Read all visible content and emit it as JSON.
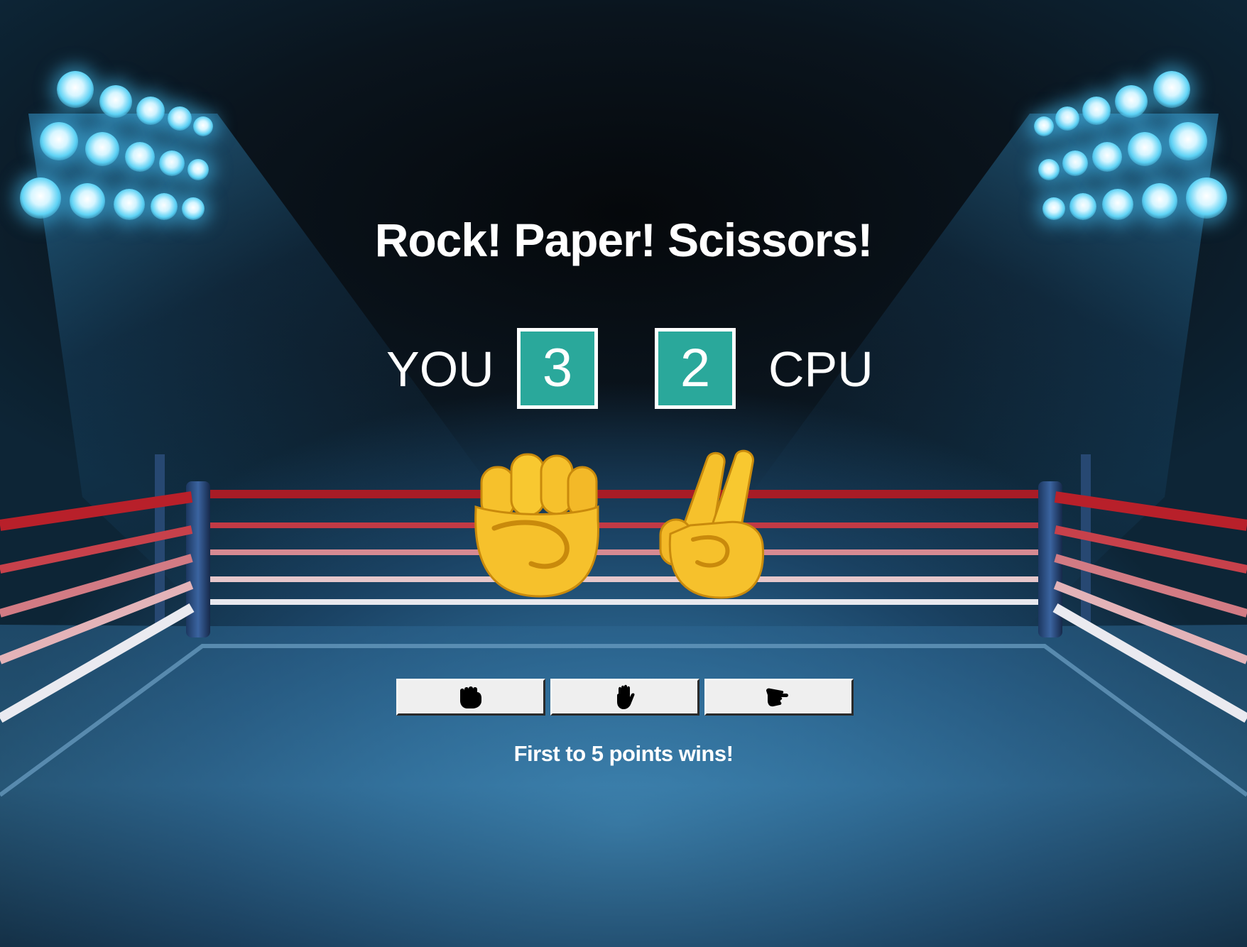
{
  "game": {
    "title": "Rock! Paper! Scissors!",
    "hint": "First to 5 points wins!"
  },
  "scoreboard": {
    "you_label": "YOU",
    "you_score": "3",
    "cpu_label": "CPU",
    "cpu_score": "2"
  },
  "play": {
    "you_hand": "raised-fist-icon",
    "cpu_hand": "victory-hand-icon"
  },
  "moves": [
    {
      "name": "rock",
      "icon": "hand-rock-icon"
    },
    {
      "name": "paper",
      "icon": "hand-paper-icon"
    },
    {
      "name": "scissors",
      "icon": "hand-scissors-icon"
    }
  ],
  "colors": {
    "score_box": "#2aa89b",
    "hand_skin": "#f6c12c",
    "rope_red": "#b8202a",
    "rope_white": "#e8e8ee"
  }
}
